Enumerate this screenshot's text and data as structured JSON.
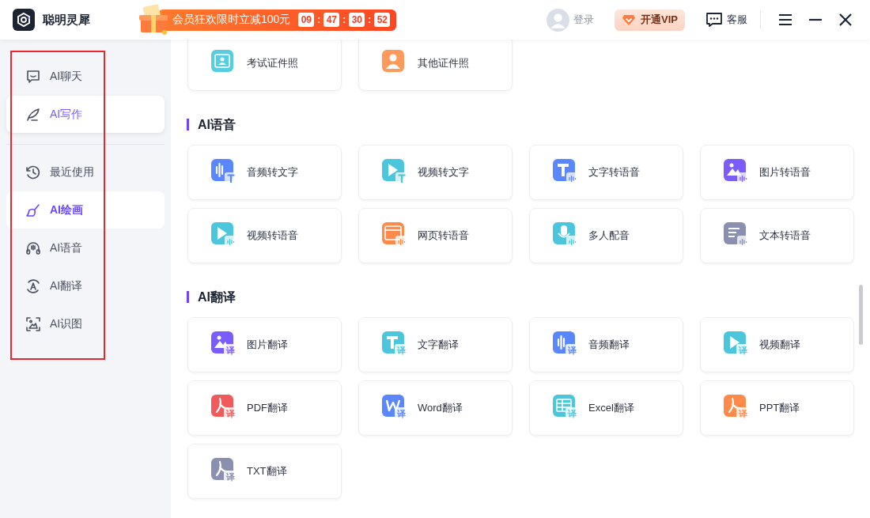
{
  "app": {
    "name": "聪明灵犀"
  },
  "promo": {
    "text": "会员狂欢限时立减100元",
    "countdown": [
      "09",
      "47",
      "30",
      "52"
    ],
    "separator": ":"
  },
  "header": {
    "login": "登录",
    "vip": "开通VIP",
    "support": "客服"
  },
  "sidebar": {
    "top_items": [
      {
        "label": "AI聊天",
        "kind": "chat",
        "selected": false,
        "hovered": false
      },
      {
        "label": "AI写作",
        "kind": "pen",
        "selected": false,
        "hovered": true
      }
    ],
    "items": [
      {
        "label": "最近使用",
        "kind": "clock",
        "selected": false,
        "hovered": false
      },
      {
        "label": "AI绘画",
        "kind": "brush",
        "selected": true,
        "hovered": false
      },
      {
        "label": "AI语音",
        "kind": "headset",
        "selected": false,
        "hovered": false
      },
      {
        "label": "AI翻译",
        "kind": "translate",
        "selected": false,
        "hovered": false
      },
      {
        "label": "AI识图",
        "kind": "scan",
        "selected": false,
        "hovered": false
      }
    ]
  },
  "sections": [
    {
      "cards": [
        {
          "label": "考试证件照",
          "kind": "idcard",
          "color": "#56cde0"
        },
        {
          "label": "其他证件照",
          "kind": "person",
          "color": "#ff9a5a"
        }
      ]
    },
    {
      "title": "AI语音",
      "cards": [
        {
          "label": "音频转文字",
          "kind": "wave",
          "color": "#5a86ff",
          "badge": {
            "kind": "t"
          }
        },
        {
          "label": "视频转文字",
          "kind": "play",
          "color": "#4cc6dc",
          "badge": {
            "kind": "t"
          }
        },
        {
          "label": "文字转语音",
          "kind": "letter",
          "color": "#5a86ff",
          "badge": {
            "kind": "sound"
          }
        },
        {
          "label": "图片转语音",
          "kind": "image",
          "color": "#7b5cff",
          "badge": {
            "kind": "sound"
          }
        },
        {
          "label": "视频转语音",
          "kind": "play",
          "color": "#4cc6dc",
          "badge": {
            "kind": "sound"
          }
        },
        {
          "label": "网页转语音",
          "kind": "web",
          "color": "#ff8a4a",
          "badge": {
            "kind": "sound"
          }
        },
        {
          "label": "多人配音",
          "kind": "mic",
          "color": "#4cc6dc",
          "badge": {
            "kind": "sound"
          }
        },
        {
          "label": "文本转语音",
          "kind": "doc",
          "color": "#8a90b0",
          "badge": {
            "kind": "sound"
          }
        }
      ]
    },
    {
      "title": "AI翻译",
      "cards": [
        {
          "label": "图片翻译",
          "kind": "image",
          "color": "#7b5cff",
          "badge": {
            "kind": "text",
            "label": "译"
          }
        },
        {
          "label": "文字翻译",
          "kind": "letter",
          "color": "#4cc6dc",
          "badge": {
            "kind": "text",
            "label": "译"
          }
        },
        {
          "label": "音频翻译",
          "kind": "wave",
          "color": "#5a86ff",
          "badge": {
            "kind": "text",
            "label": "译"
          }
        },
        {
          "label": "视频翻译",
          "kind": "play",
          "color": "#4cc6dc",
          "badge": {
            "kind": "text",
            "label": "译"
          }
        },
        {
          "label": "PDF翻译",
          "kind": "pdf",
          "color": "#f05a5a",
          "badge": {
            "kind": "text",
            "label": "译"
          }
        },
        {
          "label": "Word翻译",
          "kind": "word",
          "color": "#5a86ff",
          "badge": {
            "kind": "text",
            "label": "译"
          }
        },
        {
          "label": "Excel翻译",
          "kind": "sheet",
          "color": "#4cc6dc",
          "badge": {
            "kind": "text",
            "label": "译"
          }
        },
        {
          "label": "PPT翻译",
          "kind": "pdf",
          "color": "#ff8a4a",
          "badge": {
            "kind": "text",
            "label": "译"
          }
        },
        {
          "label": "TXT翻译",
          "kind": "pdf",
          "color": "#8a90b0",
          "badge": {
            "kind": "text",
            "label": "译"
          }
        }
      ]
    }
  ]
}
